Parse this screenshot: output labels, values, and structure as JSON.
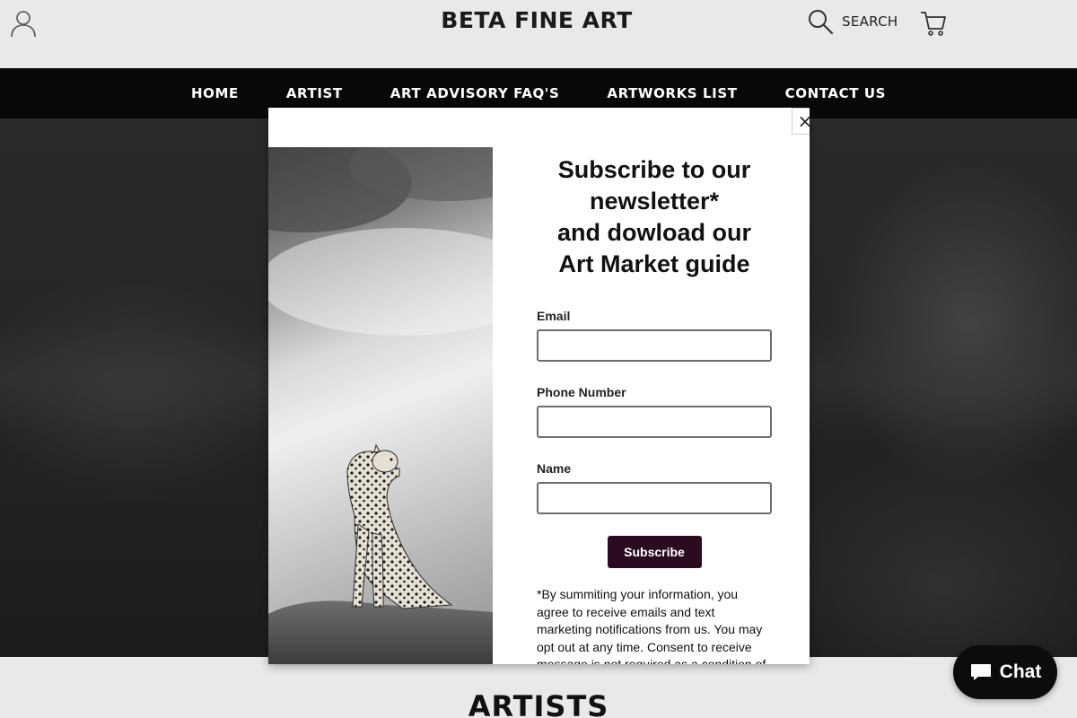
{
  "header": {
    "logo": "BETA FINE ART",
    "search_label": "SEARCH"
  },
  "nav": {
    "items": [
      "HOME",
      "ARTIST",
      "ART ADVISORY FAQ'S",
      "ARTWORKS LIST",
      "CONTACT US"
    ]
  },
  "modal": {
    "close": "×",
    "title": [
      "Subscribe to our",
      "newsletter*",
      "and dowload our",
      "Art Market guide"
    ],
    "fields": [
      {
        "label": "Email",
        "value": ""
      },
      {
        "label": "Phone Number",
        "value": ""
      },
      {
        "label": "Name",
        "value": ""
      }
    ],
    "submit": "Subscribe",
    "disclaimer": "*By summiting your information, you agree to receive emails and text marketing notifications from us. You may opt out at any time. Consent to receive message is not required as a condition of"
  },
  "section": {
    "heading": "ARTISTS"
  },
  "chat": {
    "label": "Chat"
  },
  "colors": {
    "nav_bg": "#080808",
    "subscribe_bg": "#2b0b22",
    "header_bg": "#e9e9e9"
  },
  "icons": [
    "user-icon",
    "search-icon",
    "cart-icon",
    "close-icon",
    "chat-bubble-icon"
  ]
}
